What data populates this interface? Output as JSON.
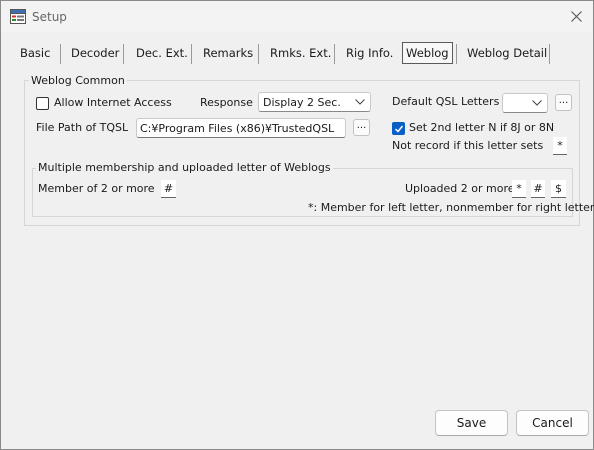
{
  "window": {
    "title": "Setup",
    "icon": "setup-window-icon"
  },
  "tabs": [
    {
      "label": "Basic"
    },
    {
      "label": "Decoder"
    },
    {
      "label": "Dec. Ext."
    },
    {
      "label": "Remarks"
    },
    {
      "label": "Rmks. Ext."
    },
    {
      "label": "Rig Info."
    },
    {
      "label": "Weblog",
      "active": true
    },
    {
      "label": "Weblog Detail"
    }
  ],
  "weblog_common": {
    "group_title": "Weblog Common",
    "allow_internet_access": {
      "label": "Allow Internet Access",
      "checked": false
    },
    "response": {
      "label": "Response",
      "value": "Display 2 Sec."
    },
    "default_qsl_letters": {
      "label": "Default QSL Letters",
      "value": "",
      "button": "..."
    },
    "file_path_tqsl": {
      "label": "File Path of TQSL",
      "value": "C:¥Program Files (x86)¥TrustedQSL",
      "button": "..."
    },
    "set_2nd_letter": {
      "label": "Set 2nd letter N if 8J or 8N",
      "checked": true
    },
    "not_record": {
      "label": "Not record if this letter sets",
      "value": "*"
    }
  },
  "multiple_membership": {
    "group_title": "Multiple membership and uploaded letter of Weblogs",
    "member_of_2_or_more": {
      "label": "Member of 2 or more",
      "value": "#"
    },
    "uploaded_2_or_more": {
      "label": "Uploaded 2 or more",
      "values": [
        "*",
        "#",
        "$"
      ]
    },
    "note": "*: Member for left letter, nonmember for right letter"
  },
  "buttons": {
    "save": "Save",
    "cancel": "Cancel"
  },
  "colors": {
    "checkbox_accent": "#0a5fc4",
    "window_bg": "#f0f0f0"
  }
}
